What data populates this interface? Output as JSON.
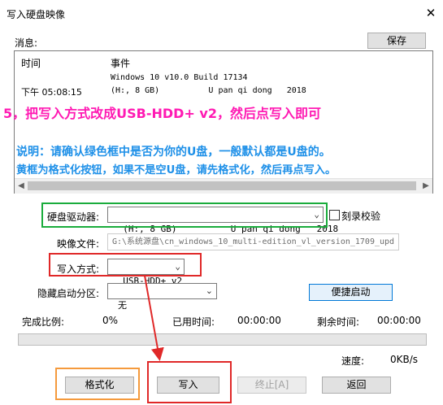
{
  "window": {
    "title": "写入硬盘映像",
    "close_glyph": "✕"
  },
  "log": {
    "label": "消息:",
    "save_label": "保存",
    "col_time": "时间",
    "col_event": "事件",
    "rows": [
      {
        "time": "",
        "event": "Windows 10 v10.0 Build 17134"
      },
      {
        "time": "下午 05:08:15",
        "event": "(H:, 8 GB)          U pan qi dong   2018"
      }
    ]
  },
  "annotations": {
    "step": "5，把写入方式改成USB-HDD+ v2，然后点写入即可",
    "note1": "说明：请确认绿色框中是否为你的U盘，一般默认都是U盘的。",
    "note2": "黄框为格式化按钮，如果不是空U盘，请先格式化，然后再点写入。"
  },
  "form": {
    "drive_label": "硬盘驱动器:",
    "drive_value": "(H:, 8 GB)          U pan qi dong   2018",
    "verify_label": "刻录校验",
    "image_label": "映像文件:",
    "image_value": "G:\\系统源盘\\cn_windows_10_multi-edition_vl_version_1709_upd",
    "write_mode_label": "写入方式:",
    "write_mode_value": "USB-HDD+ v2",
    "hidden_part_label": "隐藏启动分区:",
    "hidden_part_value": "无",
    "quick_boot_label": "便捷启动"
  },
  "status": {
    "completion_label": "完成比例:",
    "completion_value": "0%",
    "elapsed_label": "已用时间:",
    "elapsed_value": "00:00:00",
    "remaining_label": "剩余时间:",
    "remaining_value": "00:00:00",
    "progress_fraction": 0,
    "speed_label": "速度:",
    "speed_value": "0KB/s"
  },
  "buttons": {
    "format": "格式化",
    "write": "写入",
    "stop": "终止[A]",
    "back": "返回"
  },
  "colors": {
    "green_box": "#1aac3c",
    "red_box": "#e02828",
    "orange_box": "#f59a3c",
    "pink_text": "#ff1ab3",
    "blue_text": "#1e90e8"
  }
}
